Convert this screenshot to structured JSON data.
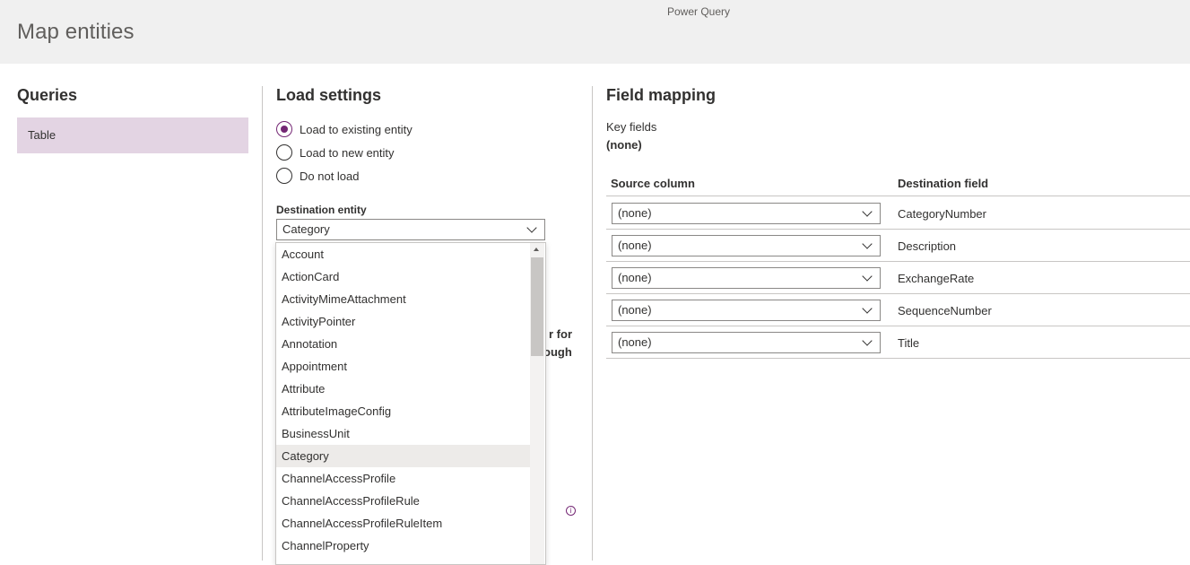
{
  "app": {
    "title": "Power Query"
  },
  "page": {
    "title": "Map entities"
  },
  "queries": {
    "title": "Queries",
    "items": [
      "Table"
    ]
  },
  "load_settings": {
    "title": "Load settings",
    "options": [
      {
        "label": "Load to existing entity",
        "checked": true
      },
      {
        "label": "Load to new entity",
        "checked": false
      },
      {
        "label": "Do not load",
        "checked": false
      }
    ],
    "destination_label": "Destination entity",
    "destination_value": "Category",
    "obscured_text_line1": "r for",
    "obscured_text_line2": "ough",
    "info_icon": "info-icon",
    "dropdown_options": [
      "Account",
      "ActionCard",
      "ActivityMimeAttachment",
      "ActivityPointer",
      "Annotation",
      "Appointment",
      "Attribute",
      "AttributeImageConfig",
      "BusinessUnit",
      "Category",
      "ChannelAccessProfile",
      "ChannelAccessProfileRule",
      "ChannelAccessProfileRuleItem",
      "ChannelProperty"
    ],
    "dropdown_selected": "Category"
  },
  "field_mapping": {
    "title": "Field mapping",
    "key_fields_label": "Key fields",
    "key_fields_value": "(none)",
    "source_column_header": "Source column",
    "destination_field_header": "Destination field",
    "rows": [
      {
        "source": "(none)",
        "destination": "CategoryNumber"
      },
      {
        "source": "(none)",
        "destination": "Description"
      },
      {
        "source": "(none)",
        "destination": "ExchangeRate"
      },
      {
        "source": "(none)",
        "destination": "SequenceNumber"
      },
      {
        "source": "(none)",
        "destination": "Title"
      }
    ]
  },
  "colors": {
    "accent": "#742774",
    "query_selected_bg": "#e3d4e3",
    "header_bg": "#f0f0f0"
  }
}
